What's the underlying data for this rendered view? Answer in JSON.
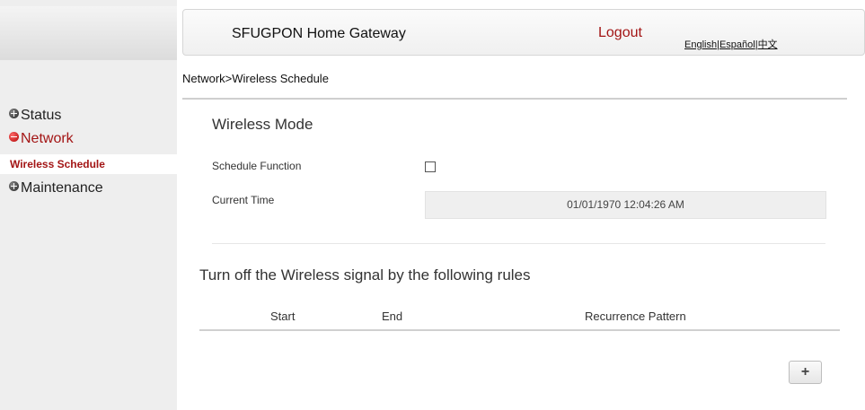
{
  "header": {
    "title": "SFUGPON Home Gateway",
    "logout": "Logout",
    "languages": [
      "English",
      "|",
      "Español",
      "|",
      "中文"
    ]
  },
  "sidebar": {
    "items": [
      {
        "label": "Status",
        "icon": "plus-icon"
      },
      {
        "label": "Network",
        "icon": "minus-icon",
        "active": true
      },
      {
        "label": "Maintenance",
        "icon": "plus-icon"
      }
    ],
    "sub_item": "Wireless Schedule"
  },
  "breadcrumb": "Network>Wireless Schedule",
  "wireless_mode": {
    "title": "Wireless Mode",
    "schedule_label": "Schedule Function",
    "schedule_checked": false,
    "time_label": "Current Time",
    "time_value": "01/01/1970 12:04:26 AM"
  },
  "rules": {
    "title": "Turn off the Wireless signal by the following rules",
    "columns": [
      "Start",
      "End",
      "Recurrence Pattern"
    ],
    "add_label": "+"
  },
  "colors": {
    "accent": "#a31515",
    "sidebar_bg": "#eeeeee"
  }
}
